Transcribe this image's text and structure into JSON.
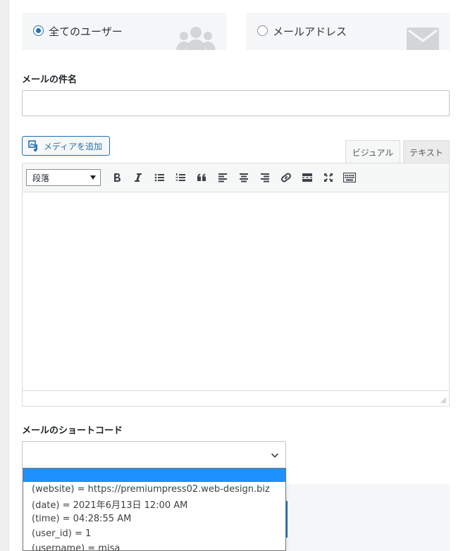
{
  "recipients": {
    "all_users": {
      "label": "全てのユーザー",
      "checked": true,
      "icon": "users-icon"
    },
    "email_address": {
      "label": "メールアドレス",
      "checked": false,
      "icon": "envelope-icon"
    }
  },
  "subject": {
    "label": "メールの件名",
    "value": ""
  },
  "editor": {
    "media_button": "メディアを追加",
    "tabs": [
      "ビジュアル",
      "テキスト"
    ],
    "active_tab": "ビジュアル",
    "format_select": "段落",
    "toolbar_icons": [
      "bold-icon",
      "italic-icon",
      "bullet-list-icon",
      "numbered-list-icon",
      "blockquote-icon",
      "align-left-icon",
      "align-center-icon",
      "align-right-icon",
      "link-icon",
      "read-more-icon",
      "fullscreen-icon",
      "keyboard-icon"
    ],
    "content": ""
  },
  "shortcodes": {
    "label": "メールのショートコード",
    "selected": "",
    "options": [
      "(website) = https://premiumpress02.web-design.biz",
      "(date) = 2021年6月13日 12:00 AM",
      "(time) = 04:28:55 AM",
      "(user_id) = 1",
      "(username) = misa"
    ]
  },
  "colors": {
    "accent": "#2271b1",
    "highlight": "#1e90ff"
  }
}
